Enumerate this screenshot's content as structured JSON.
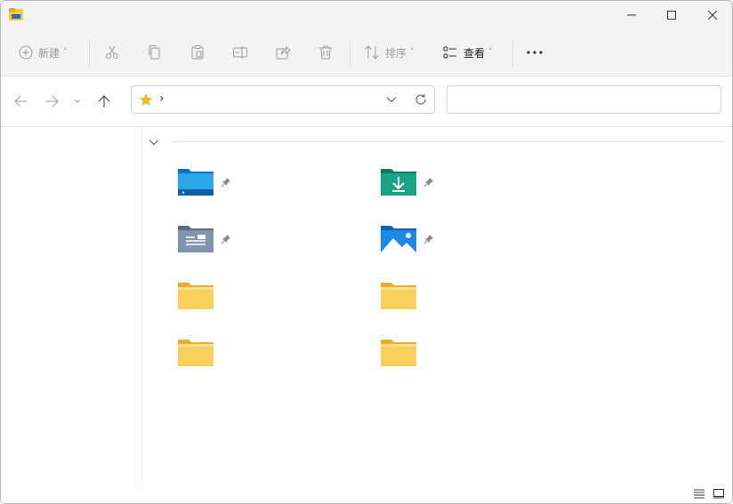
{
  "toolbar": {
    "new_label": "新建",
    "sort_label": "排序",
    "view_label": "查看"
  },
  "address": {
    "separator": "›"
  },
  "search": {
    "value": ""
  },
  "colors": {
    "folder_yellow": "#f6c64a",
    "accent_blue": "#1a8ae6",
    "download_green": "#1a9a7a",
    "docs_gray": "#7a8ea8"
  },
  "quick_access": [
    {
      "icon": "desktop-folder-icon",
      "pinned": true
    },
    {
      "icon": "downloads-folder-icon",
      "pinned": true
    },
    {
      "icon": "documents-folder-icon",
      "pinned": true
    },
    {
      "icon": "pictures-folder-icon",
      "pinned": true
    },
    {
      "icon": "folder-icon",
      "pinned": false
    },
    {
      "icon": "folder-icon",
      "pinned": false
    },
    {
      "icon": "folder-icon",
      "pinned": false
    },
    {
      "icon": "folder-icon",
      "pinned": false
    }
  ]
}
